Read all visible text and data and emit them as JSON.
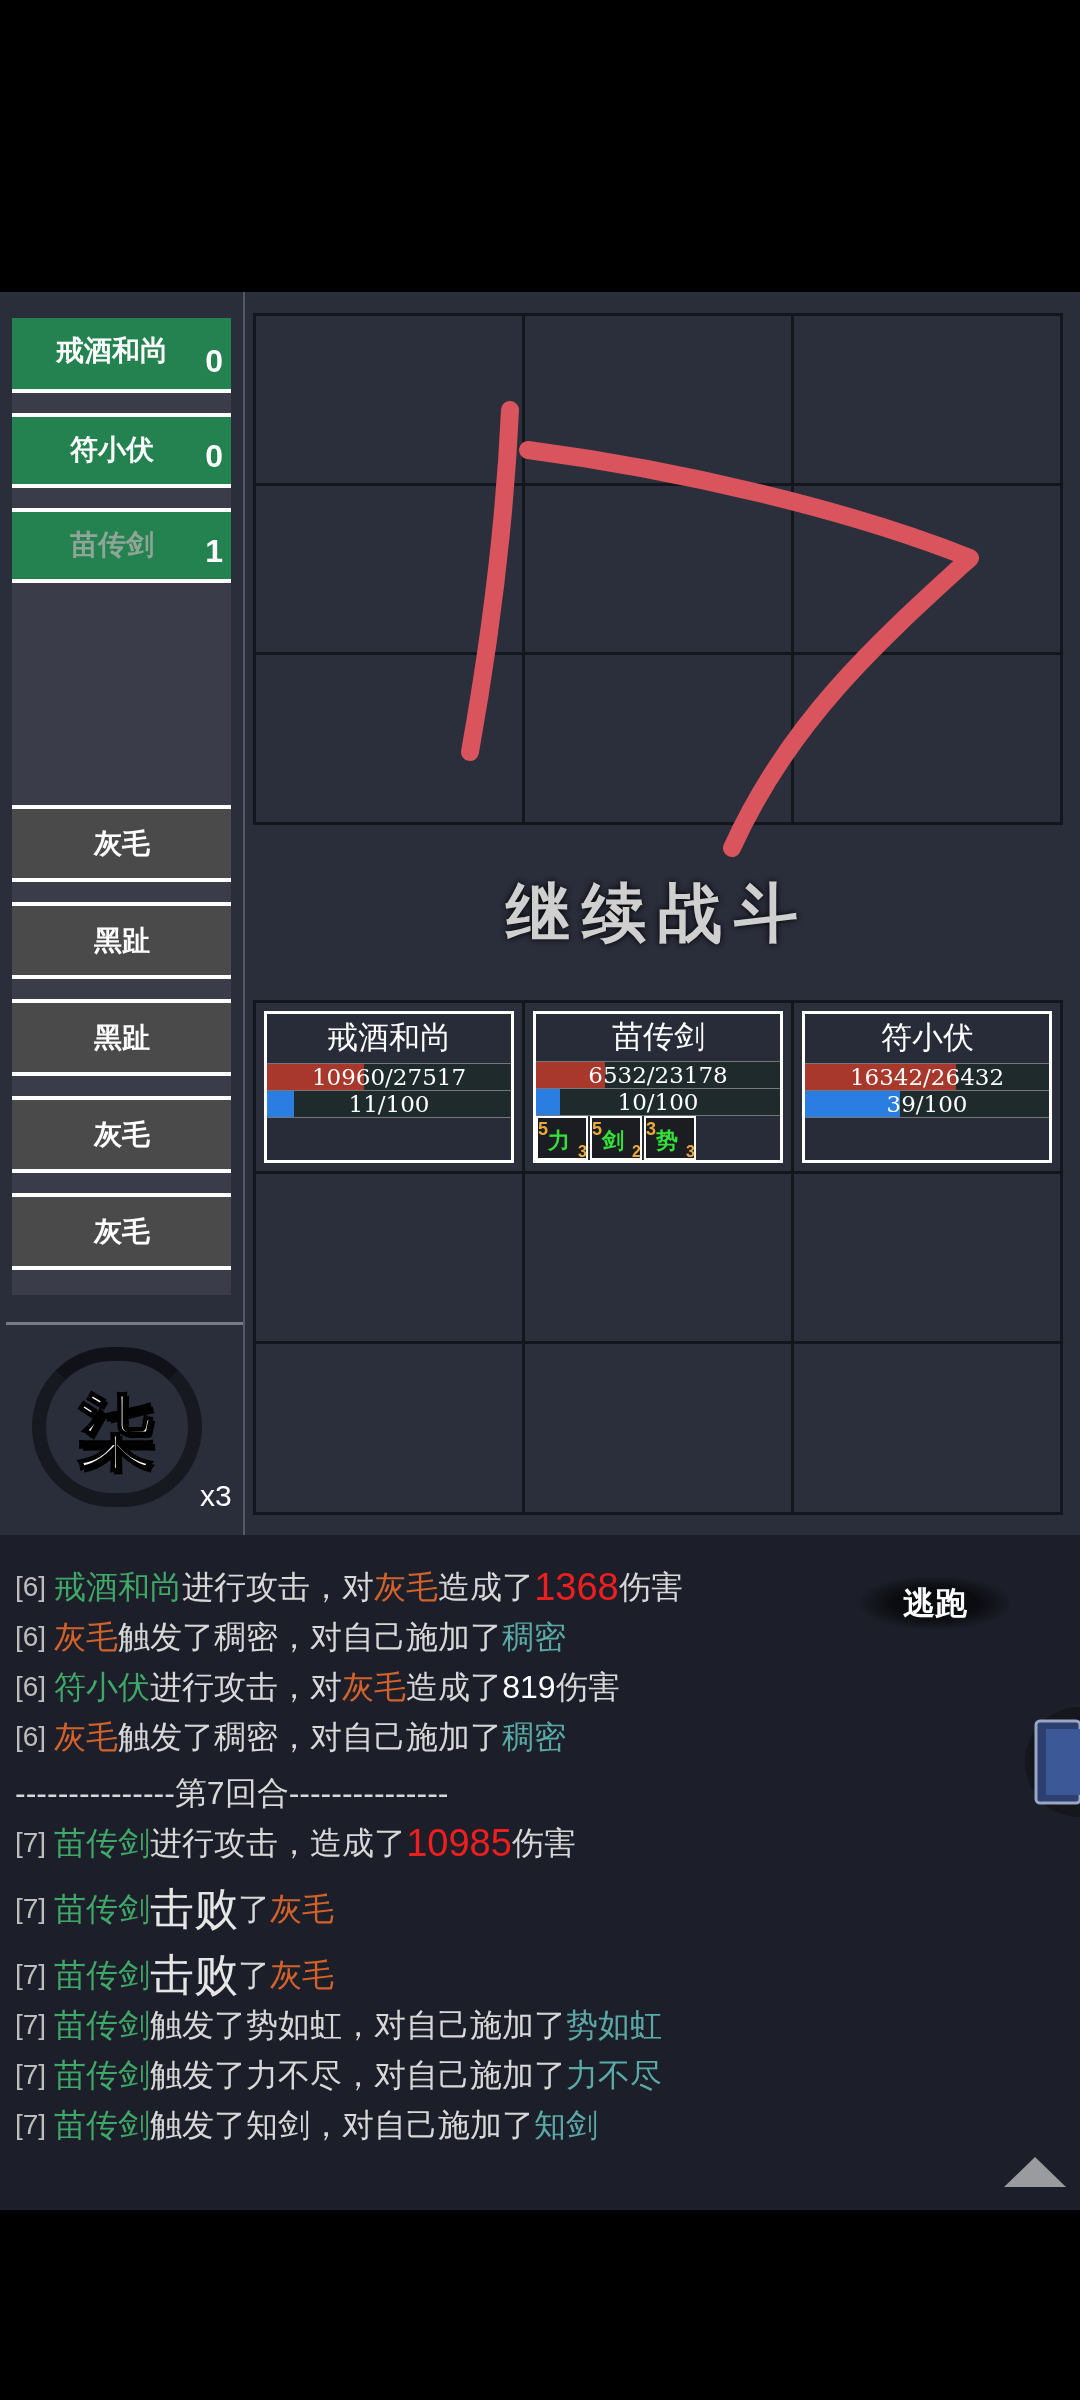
{
  "allies": [
    {
      "name": "戒酒和尚",
      "count": "0",
      "dimmed": false
    },
    {
      "name": "符小伏",
      "count": "0",
      "dimmed": false
    },
    {
      "name": "苗传剑",
      "count": "1",
      "dimmed": true
    }
  ],
  "enemies": [
    "灰毛",
    "黑趾",
    "黑趾",
    "灰毛",
    "灰毛"
  ],
  "turn_seal": {
    "label": "柒",
    "count": "x3"
  },
  "continue_button": "继续战斗",
  "party_cards": [
    {
      "name": "戒酒和尚",
      "hp": {
        "text": "10960/27517",
        "level": 0.398
      },
      "energy": {
        "text": "11/100",
        "level": 0.11
      }
    },
    {
      "name": "苗传剑",
      "hp": {
        "text": "6532/23178",
        "level": 0.282
      },
      "energy": {
        "text": "10/100",
        "level": 0.1
      },
      "buffs": [
        {
          "label": "力",
          "stacks": "5",
          "turns": "3"
        },
        {
          "label": "剑",
          "stacks": "5",
          "turns": "2"
        },
        {
          "label": "势",
          "stacks": "3",
          "turns": "3"
        }
      ]
    },
    {
      "name": "符小伏",
      "hp": {
        "text": "16342/26432",
        "level": 0.618
      },
      "energy": {
        "text": "39/100",
        "level": 0.39
      }
    }
  ],
  "escape_button": "逃跑",
  "log": [
    {
      "kind": "line",
      "parts": [
        {
          "kind": "round",
          "text": "[6]"
        },
        {
          "kind": "ally",
          "text": "戒酒和尚"
        },
        {
          "kind": "plain",
          "text": "进行攻击，对"
        },
        {
          "kind": "enemy",
          "text": "灰毛"
        },
        {
          "kind": "plain",
          "text": "造成了"
        },
        {
          "kind": "damage",
          "text": "1368"
        },
        {
          "kind": "plain",
          "text": "伤害"
        }
      ]
    },
    {
      "kind": "line",
      "parts": [
        {
          "kind": "round",
          "text": "[6]"
        },
        {
          "kind": "enemy",
          "text": "灰毛"
        },
        {
          "kind": "plain",
          "text": "触发了稠密，对自己施加了"
        },
        {
          "kind": "effect",
          "text": "稠密"
        }
      ]
    },
    {
      "kind": "line",
      "parts": [
        {
          "kind": "round",
          "text": "[6]"
        },
        {
          "kind": "ally",
          "text": "符小伏"
        },
        {
          "kind": "plain",
          "text": "进行攻击，对"
        },
        {
          "kind": "enemy",
          "text": "灰毛"
        },
        {
          "kind": "plain",
          "text": "造成了"
        },
        {
          "kind": "number",
          "text": "819"
        },
        {
          "kind": "plain",
          "text": "伤害"
        }
      ]
    },
    {
      "kind": "line",
      "parts": [
        {
          "kind": "round",
          "text": "[6]"
        },
        {
          "kind": "enemy",
          "text": "灰毛"
        },
        {
          "kind": "plain",
          "text": "触发了稠密，对自己施加了"
        },
        {
          "kind": "effect",
          "text": "稠密"
        }
      ]
    },
    {
      "kind": "separator",
      "parts": [
        {
          "kind": "plain",
          "text": "---------------第7回合---------------"
        }
      ]
    },
    {
      "kind": "line",
      "parts": [
        {
          "kind": "round",
          "text": "[7]"
        },
        {
          "kind": "ally",
          "text": "苗传剑"
        },
        {
          "kind": "plain",
          "text": "进行攻击，造成了"
        },
        {
          "kind": "damage",
          "text": "10985"
        },
        {
          "kind": "plain",
          "text": "伤害"
        }
      ]
    },
    {
      "kind": "big",
      "parts": [
        {
          "kind": "round",
          "text": "[7]"
        },
        {
          "kind": "ally",
          "text": "苗传剑"
        },
        {
          "kind": "emphasis",
          "text": "击败"
        },
        {
          "kind": "plain",
          "text": "了"
        },
        {
          "kind": "enemy",
          "text": "灰毛"
        }
      ]
    },
    {
      "kind": "big",
      "parts": [
        {
          "kind": "round",
          "text": "[7]"
        },
        {
          "kind": "ally",
          "text": "苗传剑"
        },
        {
          "kind": "emphasis",
          "text": "击败"
        },
        {
          "kind": "plain",
          "text": "了"
        },
        {
          "kind": "enemy",
          "text": "灰毛"
        }
      ]
    },
    {
      "kind": "line",
      "parts": [
        {
          "kind": "round",
          "text": "[7]"
        },
        {
          "kind": "ally",
          "text": "苗传剑"
        },
        {
          "kind": "plain",
          "text": "触发了势如虹，对自己施加了"
        },
        {
          "kind": "effect",
          "text": "势如虹"
        }
      ]
    },
    {
      "kind": "line",
      "parts": [
        {
          "kind": "round",
          "text": "[7]"
        },
        {
          "kind": "ally",
          "text": "苗传剑"
        },
        {
          "kind": "plain",
          "text": "触发了力不尽，对自己施加了"
        },
        {
          "kind": "effect",
          "text": "力不尽"
        }
      ]
    },
    {
      "kind": "line",
      "parts": [
        {
          "kind": "round",
          "text": "[7]"
        },
        {
          "kind": "ally",
          "text": "苗传剑"
        },
        {
          "kind": "plain",
          "text": "触发了知剑，对自己施加了"
        },
        {
          "kind": "effect",
          "text": "知剑"
        }
      ]
    }
  ]
}
